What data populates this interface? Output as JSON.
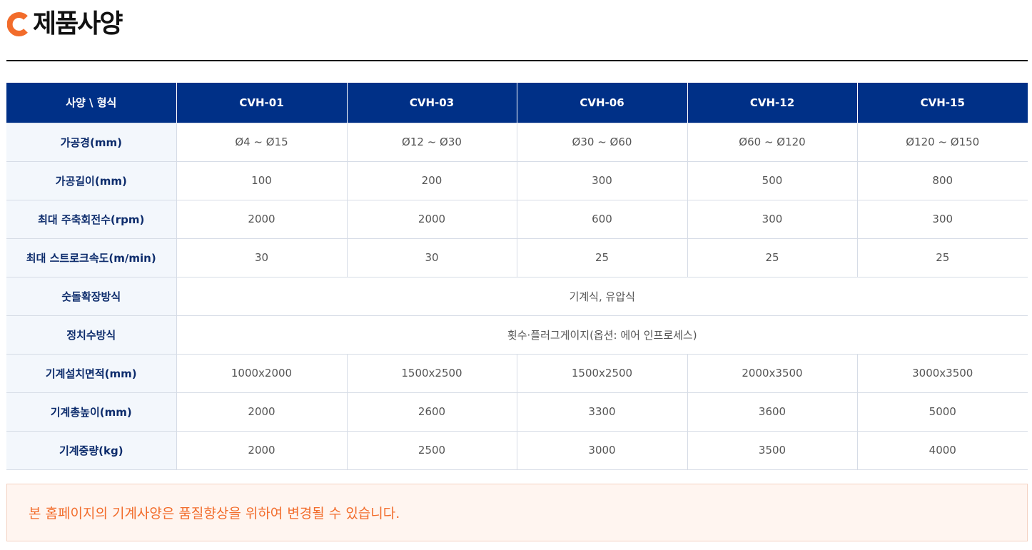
{
  "header": {
    "title": "제품사양",
    "accent_color": "#f26c2b",
    "icon": "c-logo-icon"
  },
  "table": {
    "header_color": "#003087",
    "corner_label": "사양 \\ 형식",
    "models": [
      "CVH-01",
      "CVH-03",
      "CVH-06",
      "CVH-12",
      "CVH-15"
    ],
    "rows": [
      {
        "label": "가공경(mm)",
        "values": [
          "Ø4 ~ Ø15",
          "Ø12 ~ Ø30",
          "Ø30 ~ Ø60",
          "Ø60 ~ Ø120",
          "Ø120 ~ Ø150"
        ]
      },
      {
        "label": "가공길이(mm)",
        "values": [
          "100",
          "200",
          "300",
          "500",
          "800"
        ]
      },
      {
        "label": "최대 주축회전수(rpm)",
        "values": [
          "2000",
          "2000",
          "600",
          "300",
          "300"
        ]
      },
      {
        "label": "최대 스트로크속도(m/min)",
        "values": [
          "30",
          "30",
          "25",
          "25",
          "25"
        ]
      },
      {
        "label": "숫돌확장방식",
        "merged": "기계식, 유압식"
      },
      {
        "label": "정치수방식",
        "merged": "횟수·플러그게이지(옵션: 에어 인프로세스)"
      },
      {
        "label": "기계설치면적(mm)",
        "values": [
          "1000x2000",
          "1500x2500",
          "1500x2500",
          "2000x3500",
          "3000x3500"
        ]
      },
      {
        "label": "기계총높이(mm)",
        "values": [
          "2000",
          "2600",
          "3300",
          "3600",
          "5000"
        ]
      },
      {
        "label": "기계중량(kg)",
        "values": [
          "2000",
          "2500",
          "3000",
          "3500",
          "4000"
        ]
      }
    ]
  },
  "notice": {
    "text": "본 홈페이지의 기계사양은 품질향상을 위하여 변경될 수 있습니다.",
    "color": "#f26c2b"
  }
}
